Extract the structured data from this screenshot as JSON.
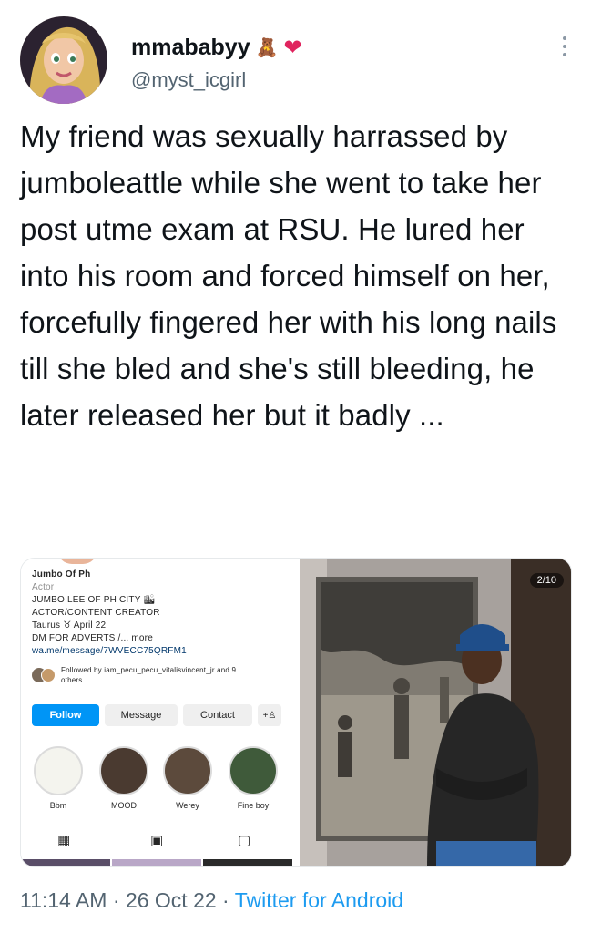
{
  "user": {
    "display_name": "mmababyy",
    "badges": [
      "🧸",
      "❤"
    ],
    "handle": "@myst_icgirl"
  },
  "tweet": {
    "text": "My friend was sexually harrassed by jumboleattle while she went to take her post utme exam at RSU. He lured her into his room and forced himself on her, forcefully fingered her with his long nails till she bled and she's still bleeding, he later released her but it badly ..."
  },
  "media_left": {
    "profile_name": "Jumbo Of Ph",
    "category": "Actor",
    "bio_lines": [
      "JUMBO LEE OF PH CITY 🏙",
      "ACTOR/CONTENT CREATOR",
      "Taurus ♉ April 22",
      "DM FOR ADVERTS /... more"
    ],
    "link": "wa.me/message/7WVECC75QRFM1",
    "followed_by": "Followed by iam_pecu_pecu_vitalisvincent_jr and 9",
    "followed_by_more": "others",
    "buttons": {
      "follow": "Follow",
      "message": "Message",
      "contact": "Contact",
      "add_user": "+♙"
    },
    "highlights": [
      "Bbm",
      "MOOD",
      "Werey",
      "Fine boy"
    ],
    "tab_icons": [
      "grid-icon",
      "reels-icon",
      "tagged-icon"
    ]
  },
  "media_right": {
    "counter": "2/10"
  },
  "footer": {
    "time": "11:14 AM",
    "separator": " · ",
    "date": "26 Oct 22",
    "separator2": " · ",
    "source": "Twitter for Android"
  },
  "colors": {
    "text": "#0f1419",
    "secondary": "#536471",
    "link": "#1d9bf0",
    "ig_follow": "#0095f6"
  }
}
